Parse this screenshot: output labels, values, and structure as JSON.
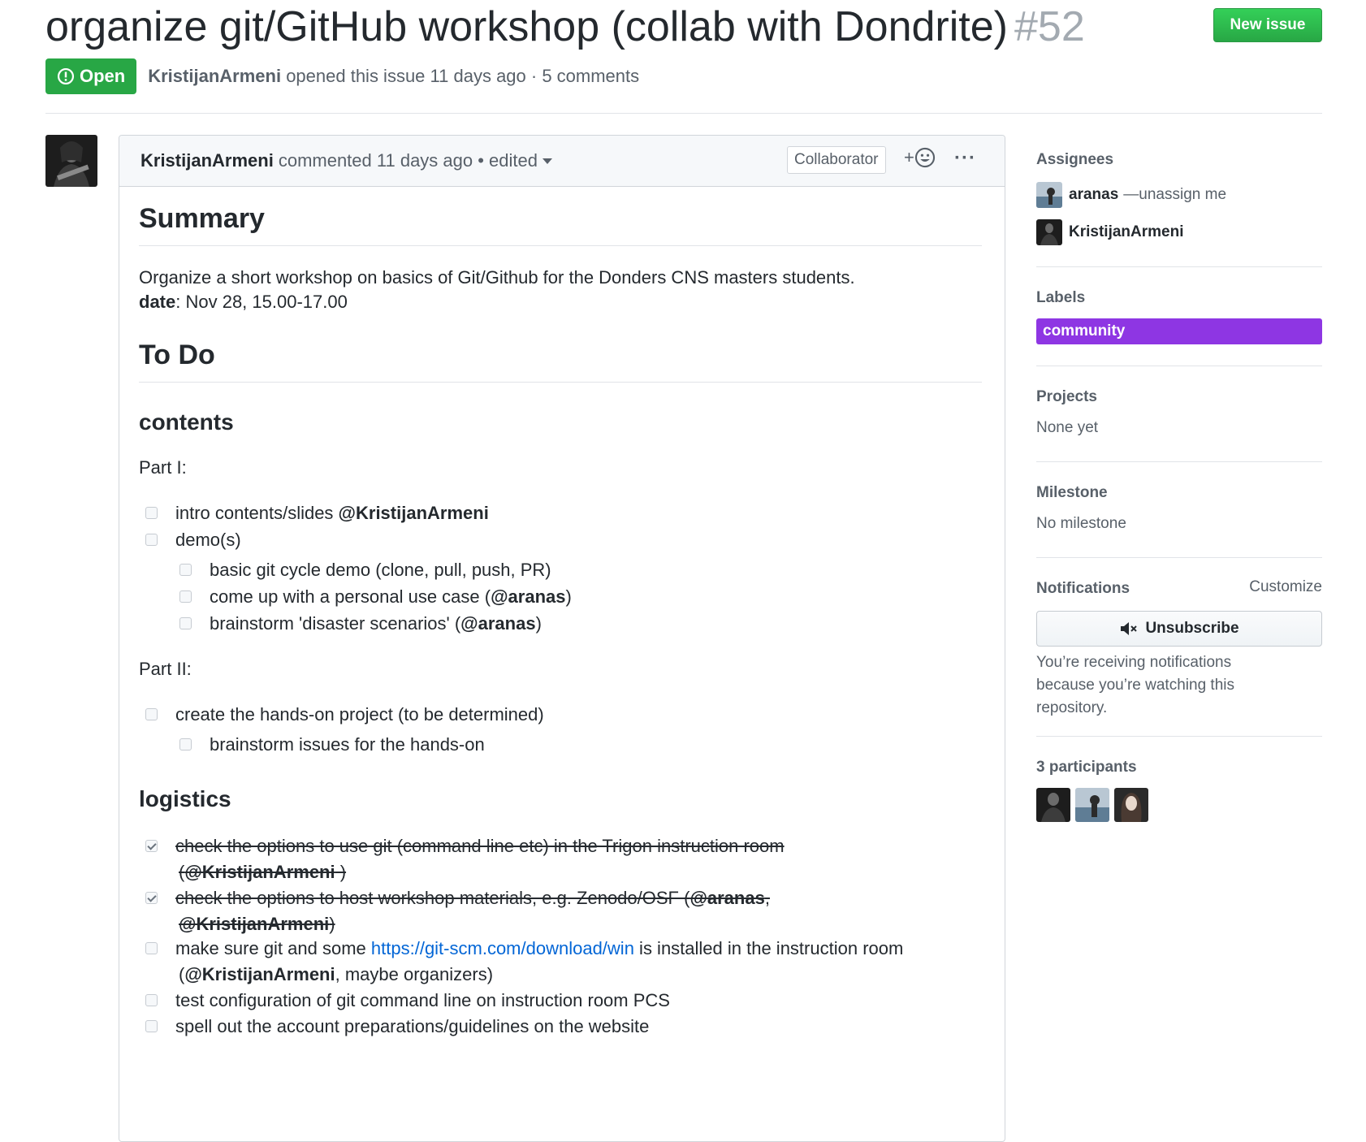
{
  "issue": {
    "title": "organize git/GitHub workshop (collab with Dondrite)",
    "number": "#52",
    "state": "Open",
    "author": "KristijanArmeni",
    "meta": "opened this issue 11 days ago · 5 comments"
  },
  "header": {
    "new_issue_label": "New issue"
  },
  "comment": {
    "author": "KristijanArmeni",
    "meta": "commented 11 days ago • edited",
    "role_badge": "Collaborator",
    "reaction_label": "+",
    "more_label": "···"
  },
  "body": {
    "summary_heading": "Summary",
    "summary_text": "Organize a short workshop on basics of Git/Github for the Donders CNS masters students.",
    "date_label": "date",
    "date_value": ": Nov 28, 15.00-17.00",
    "todo_heading": "To Do",
    "contents_heading": "contents",
    "part1": "Part I:",
    "part2": "Part II:",
    "logistics_heading": "logistics",
    "tasks": {
      "t1_text": "intro contents/slides ",
      "t1_mention": "@KristijanArmeni",
      "t2_text": "demo(s)",
      "t3_text": "basic git cycle demo (clone, pull, push, PR)",
      "t4_text": "come up with a personal use case (",
      "t4_mention": "@aranas",
      "t4_end": ")",
      "t5_text": "brainstorm 'disaster scenarios' (",
      "t5_mention": "@aranas",
      "t5_end": ")",
      "t6_text": "create the hands-on project (to be determined)",
      "t7_text": "brainstorm issues for the hands-on",
      "l1_line1": "check the options to use git (command line etc) in the Trigon instruction room",
      "l1_line2_open": "(",
      "l1_line2_mention": "@KristijanArmeni",
      "l1_line2_close": " )",
      "l2_line1": "check the options to host workshop materials, e.g. Zenodo/OSF (",
      "l2_line1_mention": "@aranas",
      "l2_line1_end": ",",
      "l2_line2_mention": "@KristijanArmeni",
      "l2_line2_end": ")",
      "l3_text": "make sure git and some ",
      "l3_link": "https://git-scm.com/download/win",
      "l3_end": " is installed in the instruction room",
      "l3_line2_open": "(",
      "l3_line2_mention": "@KristijanArmeni",
      "l3_line2_end": ", maybe organizers)",
      "l4_text": "test configuration of git command line on instruction room PCS",
      "l5_text": "spell out the account preparations/guidelines on the website"
    }
  },
  "sidebar": {
    "assignees_heading": "Assignees",
    "assignee1": "aranas",
    "assignee1_action": "—unassign me",
    "assignee2": "KristijanArmeni",
    "labels_heading": "Labels",
    "label1": "community",
    "label1_color": "#8e36e3",
    "projects_heading": "Projects",
    "projects_value": "None yet",
    "milestone_heading": "Milestone",
    "milestone_value": "No milestone",
    "notifications_heading": "Notifications",
    "customize_label": "Customize",
    "unsubscribe_label": "Unsubscribe",
    "notif_reason": "You’re receiving notifications because you’re watching this repository.",
    "participants_heading": "3 participants"
  },
  "colors": {
    "open_green": "#28a745",
    "link_blue": "#0366d6",
    "label_purple": "#8e36e3"
  }
}
